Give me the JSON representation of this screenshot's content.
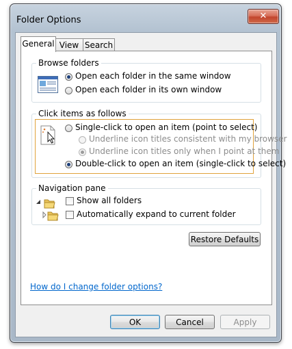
{
  "window": {
    "title": "Folder Options",
    "close_glyph": "✕"
  },
  "tabs": [
    {
      "label": "General"
    },
    {
      "label": "View"
    },
    {
      "label": "Search"
    }
  ],
  "browse_folders": {
    "title": "Browse folders",
    "options": [
      {
        "label": "Open each folder in the same window",
        "checked": true
      },
      {
        "label": "Open each folder in its own window",
        "checked": false
      }
    ]
  },
  "click_items": {
    "title": "Click items as follows",
    "single_click": "Single-click to open an item (point to select)",
    "underline_browser": "Underline icon titles consistent with my browser",
    "underline_point": "Underline icon titles only when I point at them",
    "double_click": "Double-click to open an item (single-click to select)"
  },
  "navigation_pane": {
    "title": "Navigation pane",
    "show_all_folders": "Show all folders",
    "auto_expand": "Automatically expand to current folder"
  },
  "buttons": {
    "restore_defaults": "Restore Defaults",
    "ok": "OK",
    "cancel": "Cancel",
    "apply": "Apply"
  },
  "help_link": "How do I change folder options?"
}
